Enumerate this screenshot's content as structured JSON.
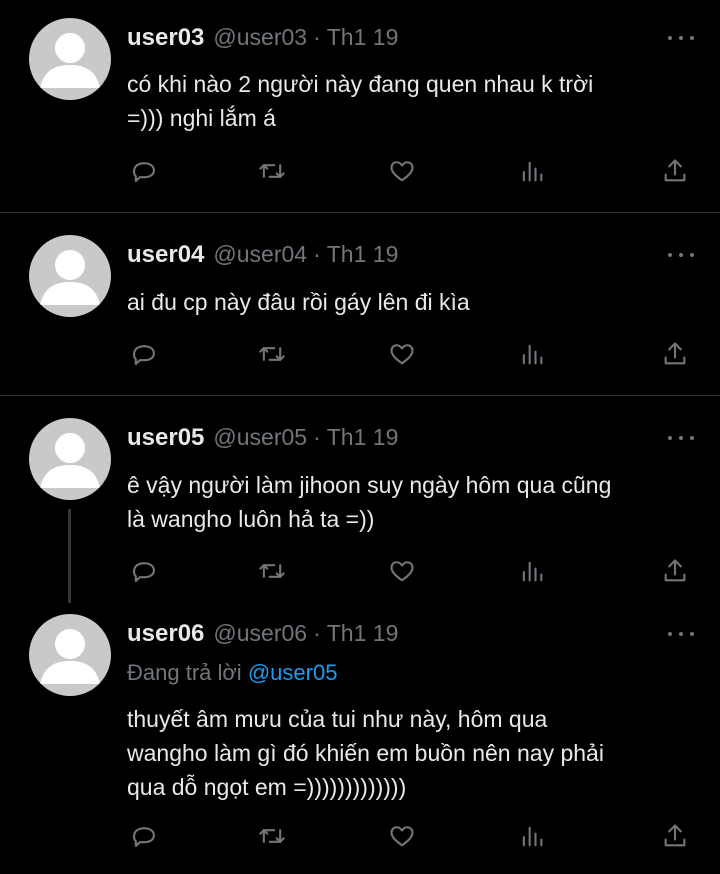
{
  "tweets": [
    {
      "name": "user03",
      "handle": "@user03",
      "dot": "·",
      "date": "Th1 19",
      "text_lines": [
        "có khi nào 2 người này đang quen nhau k trời",
        "=))) nghi lắm á"
      ]
    },
    {
      "name": "user04",
      "handle": "@user04",
      "dot": "·",
      "date": "Th1 19",
      "text_lines": [
        "ai đu cp này đâu rồi gáy lên đi kìa"
      ]
    },
    {
      "name": "user05",
      "handle": "@user05",
      "dot": "·",
      "date": "Th1 19",
      "text_lines": [
        "ê vậy người làm jihoon suy ngày hôm qua cũng",
        "là wangho luôn hả ta =))"
      ]
    },
    {
      "name": "user06",
      "handle": "@user06",
      "dot": "·",
      "date": "Th1 19",
      "reply_prefix": "Đang trả lời",
      "reply_mention": "@user05",
      "text_lines": [
        "thuyết âm mưu của tui như này, hôm qua",
        "wangho làm gì đó khiến em buồn nên nay phải",
        "qua dỗ ngọt em =)))))))))))))"
      ]
    }
  ],
  "icons": {
    "reply": "speech-bubble-icon",
    "retweet": "retweet-icon",
    "like": "heart-icon",
    "views": "bar-chart-icon",
    "share": "share-upload-icon",
    "more": "more-dots-icon"
  },
  "colors": {
    "background": "#000000",
    "text": "#e7e9ea",
    "muted": "#71767b",
    "mention": "#1d9bf0",
    "divider": "#2f3336",
    "avatar": "#c9c9cc"
  }
}
